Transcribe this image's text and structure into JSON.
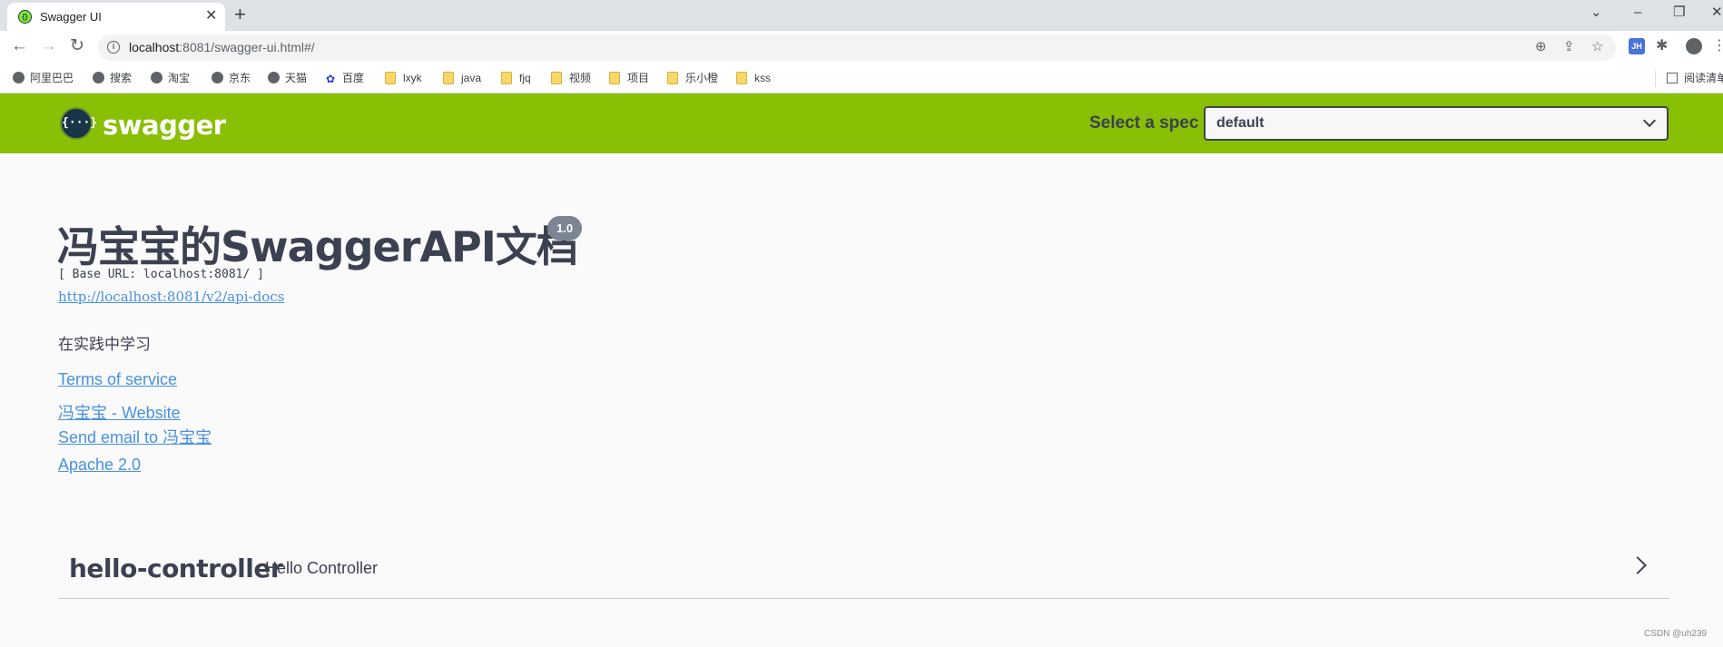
{
  "browser": {
    "tab_title": "Swagger UI",
    "url_host": "localhost",
    "url_rest": ":8081/swagger-ui.html#/",
    "bookmarks": [
      {
        "label": "阿里巴巴",
        "icon": "globe-icon"
      },
      {
        "label": "搜索",
        "icon": "globe-icon"
      },
      {
        "label": "淘宝",
        "icon": "globe-icon"
      },
      {
        "label": "京东",
        "icon": "globe-icon"
      },
      {
        "label": "天猫",
        "icon": "globe-icon"
      },
      {
        "label": "百度",
        "icon": "baidu-paw-icon"
      },
      {
        "label": "lxyk",
        "icon": "folder-icon"
      },
      {
        "label": "java",
        "icon": "folder-icon"
      },
      {
        "label": "fjq",
        "icon": "folder-icon"
      },
      {
        "label": "视频",
        "icon": "folder-icon"
      },
      {
        "label": "项目",
        "icon": "folder-icon"
      },
      {
        "label": "乐小橙",
        "icon": "folder-icon"
      },
      {
        "label": "kss",
        "icon": "folder-icon"
      }
    ],
    "reading_list_label": "阅读清单",
    "extension_badge": "JH"
  },
  "topbar": {
    "logo_glyph": "{···}",
    "logo_text": "swagger",
    "spec_label": "Select a spec",
    "spec_value": "default",
    "brand_color": "#89bf04"
  },
  "info": {
    "title": "冯宝宝的SwaggerAPI文档",
    "version": "1.0",
    "base_url": "[ Base URL: localhost:8081/ ]",
    "api_docs_link": "http://localhost:8081/v2/api-docs",
    "description": "在实践中学习",
    "terms_link": "Terms of service",
    "website_link": "冯宝宝 - Website",
    "email_link": "Send email to 冯宝宝",
    "license_link": "Apache 2.0"
  },
  "tags": [
    {
      "name": "hello-controller",
      "description": "Hello Controller"
    }
  ],
  "watermark": "CSDN @uh239"
}
